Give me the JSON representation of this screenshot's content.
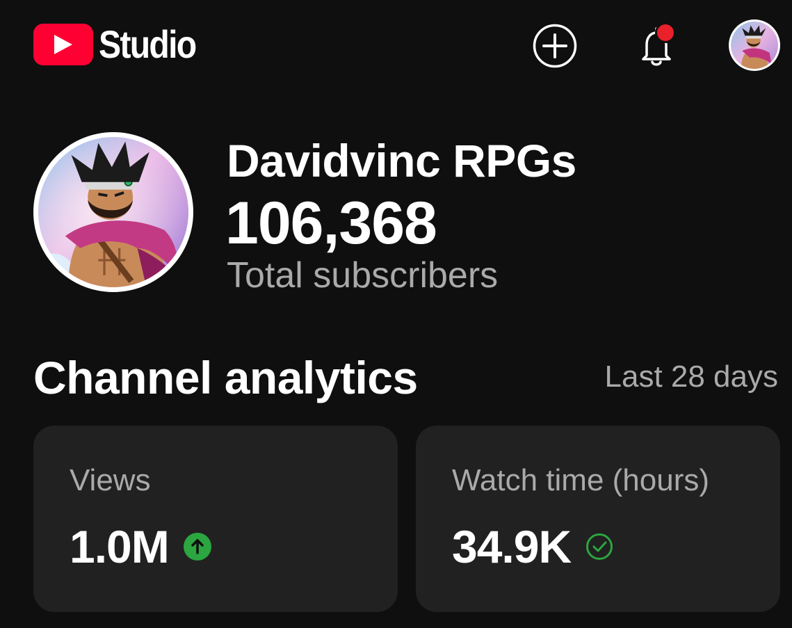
{
  "header": {
    "logo_text": "Studio",
    "icons": {
      "logo": "youtube-play-icon",
      "create": "plus-circle-icon",
      "notifications": "bell-icon",
      "account": "avatar"
    },
    "notification_dot_color": "#e8212b",
    "brand_color": "#ff0033"
  },
  "channel": {
    "name": "Davidvinc RPGs",
    "subscriber_count": "106,368",
    "subscriber_label": "Total subscribers"
  },
  "analytics": {
    "title": "Channel analytics",
    "period": "Last 28 days",
    "cards": [
      {
        "label": "Views",
        "value": "1.0M",
        "indicator": "arrow-up-circle-icon",
        "indicator_color": "#2ba640"
      },
      {
        "label": "Watch time (hours)",
        "value": "34.9K",
        "indicator": "check-circle-icon",
        "indicator_color": "#2ba640"
      }
    ]
  },
  "theme": {
    "background": "#0f0f0f",
    "card_background": "#212121",
    "primary_text": "#ffffff",
    "secondary_text": "#aaaaaa"
  }
}
